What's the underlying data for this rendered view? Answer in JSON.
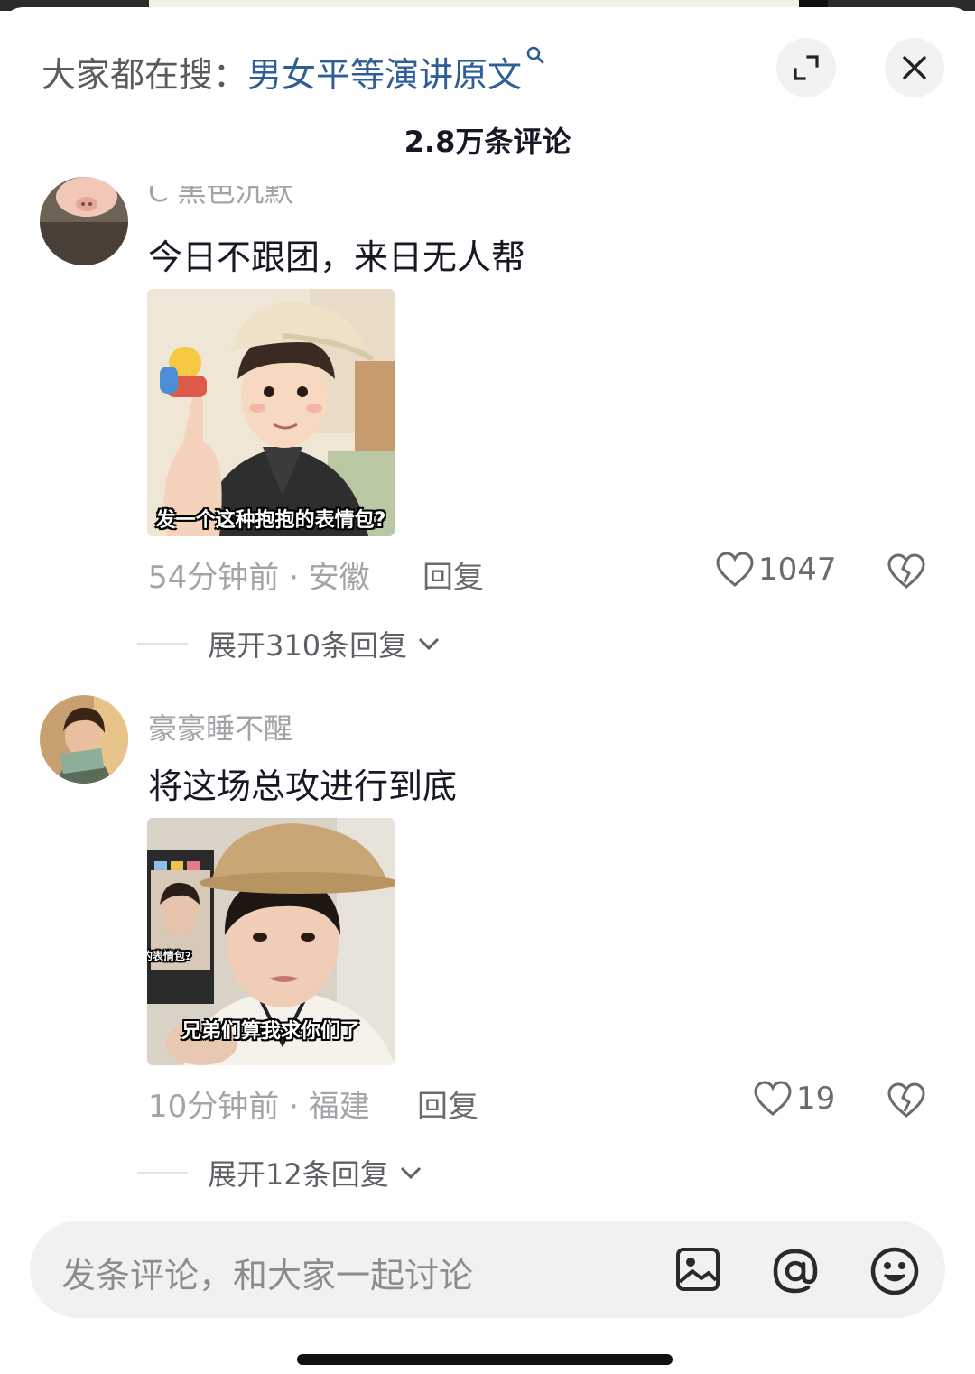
{
  "header": {
    "search_label": "大家都在搜：",
    "search_keyword": "男女平等演讲原文",
    "comment_count": "2.8万条评论"
  },
  "comments": [
    {
      "username": "C 黑色沉默",
      "text": "今日不跟团，来日无人帮",
      "image_caption": "发一个这种抱抱的表情包?",
      "time_location": "54分钟前 · 安徽",
      "reply_label": "回复",
      "likes": "1047",
      "expand_replies": "展开310条回复"
    },
    {
      "username": "豪豪睡不醒",
      "text": "将这场总攻进行到底",
      "image_caption": "兄弟们算我求你们了",
      "image_inset_caption": "抱抱的表情包?",
      "time_location": "10分钟前 · 福建",
      "reply_label": "回复",
      "likes": "19",
      "expand_replies": "展开12条回复"
    }
  ],
  "input": {
    "placeholder": "发条评论，和大家一起讨论"
  },
  "icons": {
    "search_keyword_icon": "search-icon",
    "expand": "expand-icon",
    "close": "close-icon",
    "like": "heart-icon",
    "dislike": "broken-heart-icon",
    "image": "image-icon",
    "mention": "at-icon",
    "emoji": "emoji-icon"
  },
  "colors": {
    "keyword": "#2f5d95",
    "secondary_text": "#a3a3a8"
  }
}
